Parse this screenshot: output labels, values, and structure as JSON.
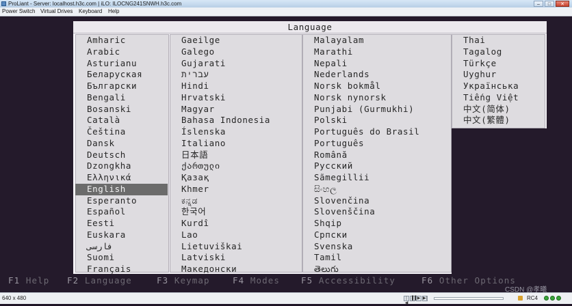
{
  "window": {
    "title": "ProLiant - Server: localhost.h3c.com | iLO: ILOCNG241SNWH.h3c.com",
    "buttons": [
      "–",
      "□",
      "✕"
    ]
  },
  "menubar": {
    "items": [
      "Power Switch",
      "Virtual Drives",
      "Keyboard",
      "Help"
    ]
  },
  "dialog": {
    "title": "Language",
    "columns": [
      [
        "Amharic",
        "Arabic",
        "Asturianu",
        "Беларуская",
        "Български",
        "Bengali",
        "Bosanski",
        "Català",
        "Čeština",
        "Dansk",
        "Deutsch",
        "Dzongkha",
        "Ελληνικά",
        "English",
        "Esperanto",
        "Español",
        "Eesti",
        "Euskara",
        "فارسی",
        "Suomi",
        "Français"
      ],
      [
        "Gaeilge",
        "Galego",
        "Gujarati",
        "עברית",
        "Hindi",
        "Hrvatski",
        "Magyar",
        "Bahasa Indonesia",
        "Íslenska",
        "Italiano",
        "日本語",
        "ქართული",
        "Қазақ",
        "Khmer",
        "ಕನ್ನಡ",
        "한국어",
        "Kurdî",
        "Lao",
        "Lietuviškai",
        "Latviski",
        "Македонски"
      ],
      [
        "Malayalam",
        "Marathi",
        "Nepali",
        "Nederlands",
        "Norsk bokmål",
        "Norsk nynorsk",
        "Punjabi (Gurmukhi)",
        "Polski",
        "Português do Brasil",
        "Português",
        "Română",
        "Русский",
        "Sãmegillii",
        "සිංහල",
        "Slovenčina",
        "Slovenščina",
        "Shqip",
        "Српски",
        "Svenska",
        "Tamil",
        "తెలుగు"
      ],
      [
        "Thai",
        "Tagalog",
        "Türkçe",
        "Uyghur",
        "Українська",
        "Tiếng Việt",
        "中文(简体)",
        "中文(繁體)"
      ]
    ],
    "selected": "English"
  },
  "fkeys": [
    {
      "key": "F1",
      "label": "Help"
    },
    {
      "key": "F2",
      "label": "Language"
    },
    {
      "key": "F3",
      "label": "Keymap"
    },
    {
      "key": "F4",
      "label": "Modes"
    },
    {
      "key": "F5",
      "label": "Accessibility"
    },
    {
      "key": "F6",
      "label": "Other Options"
    }
  ],
  "statusbar": {
    "resolution": "640 x 480",
    "media_buttons": [
      "|◀",
      "▐▐",
      "▶",
      "▶|"
    ],
    "encryption": "RC4",
    "watermark": "CSDN @孝曦"
  },
  "icons": {
    "app": "app-icon",
    "lock": "lock-icon",
    "status": "status-indicator-icon"
  },
  "colors": {
    "screen_bg": "#241a2b",
    "dialog_bg": "#dedce0",
    "selected_bg": "#6b6b6b"
  }
}
